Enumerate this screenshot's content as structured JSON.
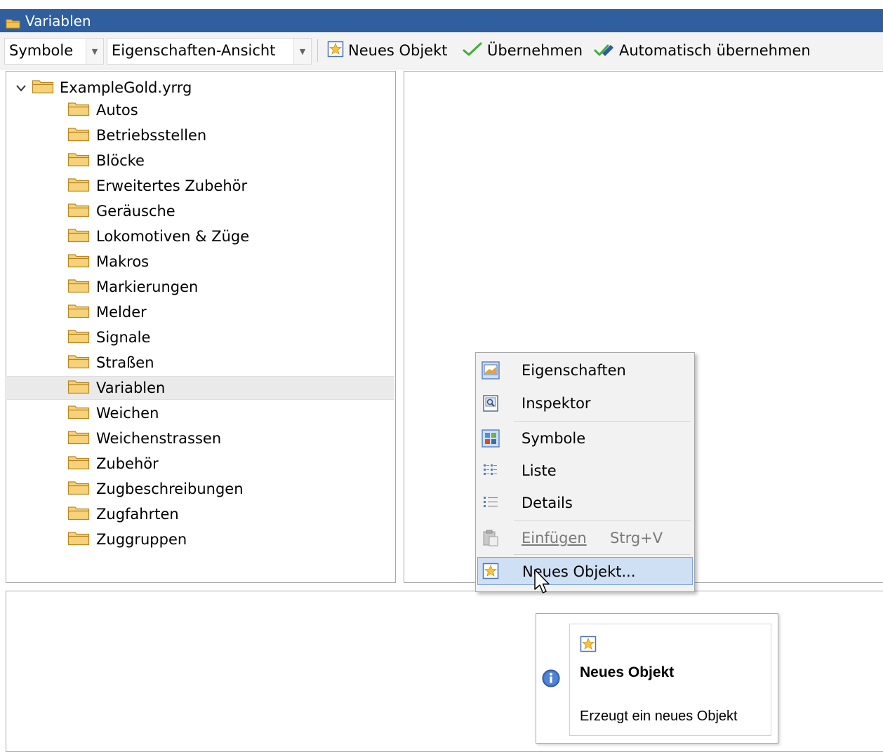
{
  "window": {
    "title": "Variablen"
  },
  "toolbar": {
    "view_combo": "Symbole",
    "mode_combo": "Eigenschaften-Ansicht",
    "new_object": "Neues Objekt",
    "apply": "Übernehmen",
    "auto_apply": "Automatisch übernehmen"
  },
  "tree": {
    "root": "ExampleGold.yrrg",
    "items": [
      "Autos",
      "Betriebsstellen",
      "Blöcke",
      "Erweitertes Zubehör",
      "Geräusche",
      "Lokomotiven & Züge",
      "Makros",
      "Markierungen",
      "Melder",
      "Signale",
      "Straßen",
      "Variablen",
      "Weichen",
      "Weichenstrassen",
      "Zubehör",
      "Zugbeschreibungen",
      "Zugfahrten",
      "Zuggruppen"
    ],
    "selected": "Variablen"
  },
  "context_menu": {
    "properties": "Eigenschaften",
    "inspector": "Inspektor",
    "symbols": "Symbole",
    "list": "Liste",
    "details": "Details",
    "paste": "Einfügen",
    "paste_shortcut": "Strg+V",
    "new_object": "Neues Objekt..."
  },
  "tooltip": {
    "title": "Neues Objekt",
    "description": "Erzeugt ein neues Objekt"
  },
  "colors": {
    "titlebar": "#2f5f9e",
    "selection": "#eaeaea",
    "menu_highlight": "#cfe0f5",
    "menu_highlight_border": "#79a4dc"
  }
}
